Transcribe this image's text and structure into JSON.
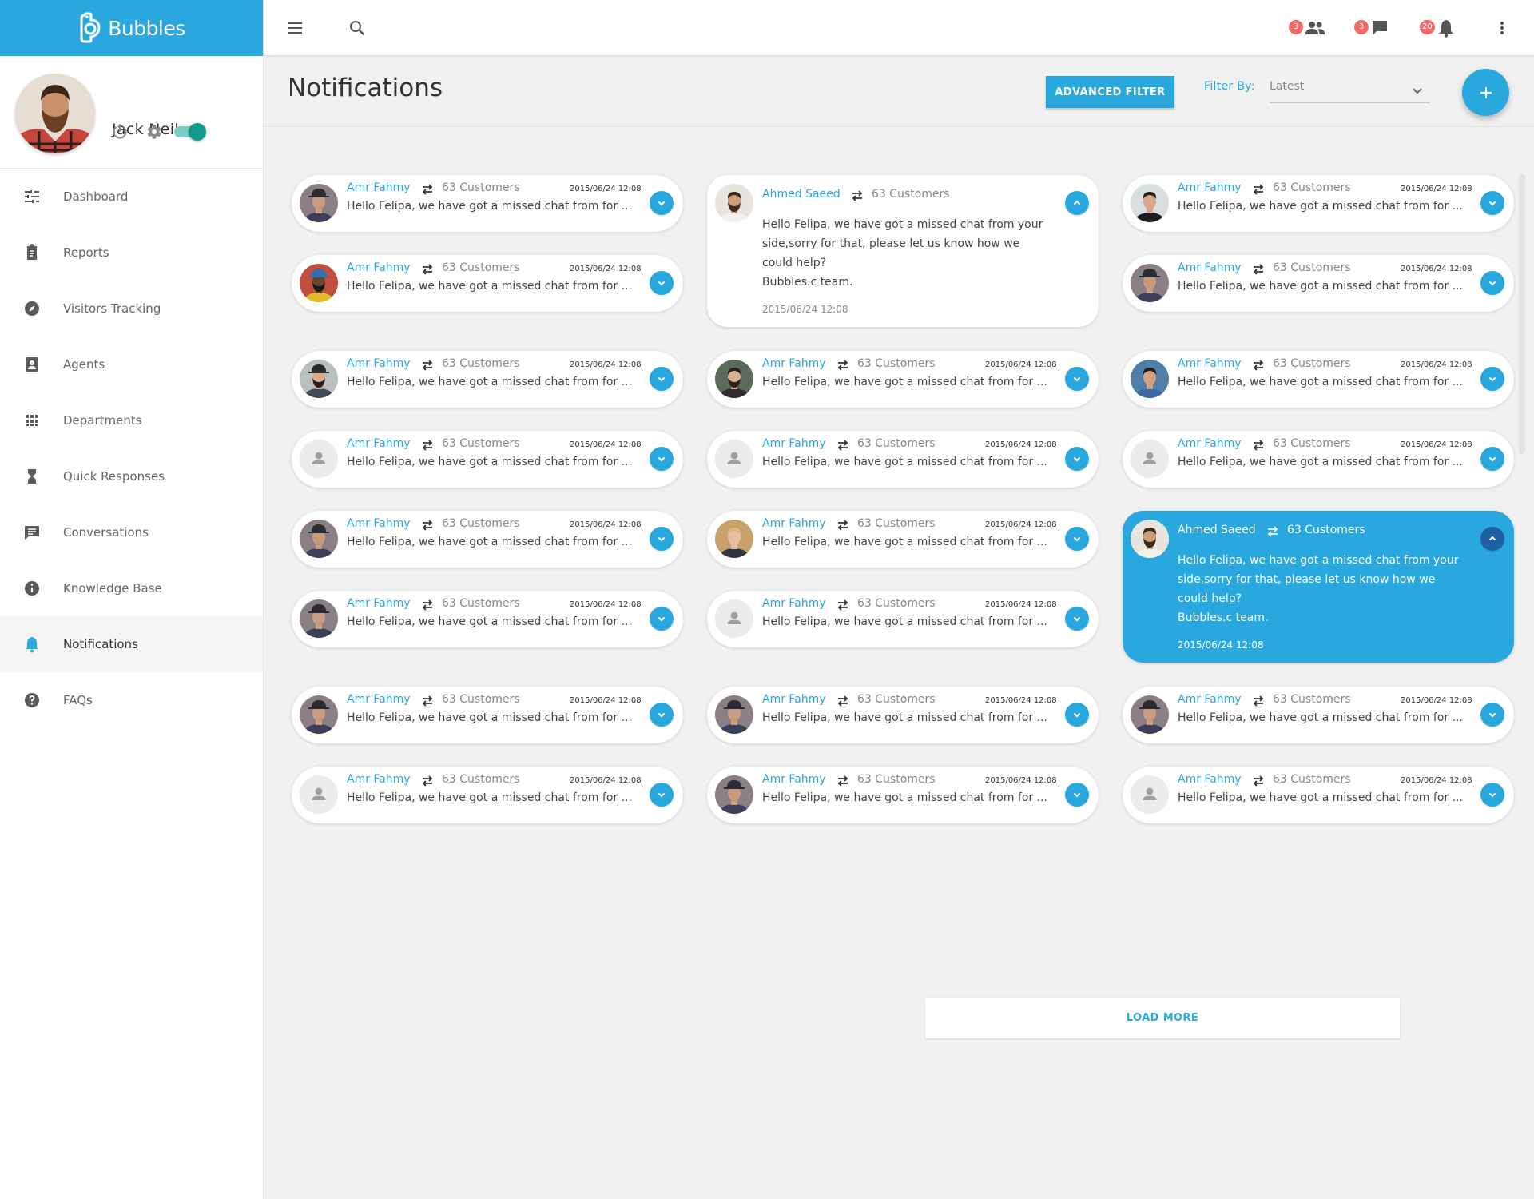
{
  "brand": {
    "name": "Bubbles"
  },
  "user": {
    "name": "Jack Neil"
  },
  "nav": [
    {
      "label": "Dashboard",
      "icon": "tune"
    },
    {
      "label": "Reports",
      "icon": "clipboard"
    },
    {
      "label": "Visitors Tracking",
      "icon": "compass"
    },
    {
      "label": "Agents",
      "icon": "person-box"
    },
    {
      "label": "Departments",
      "icon": "grid"
    },
    {
      "label": "Quick Responses",
      "icon": "hourglass"
    },
    {
      "label": "Conversations",
      "icon": "chat"
    },
    {
      "label": "Knowledge Base",
      "icon": "info"
    },
    {
      "label": "Notifications",
      "icon": "bell",
      "active": true
    },
    {
      "label": "FAQs",
      "icon": "help"
    }
  ],
  "topbar": {
    "badges": {
      "people": "3",
      "chat": "3",
      "notifications": "20"
    }
  },
  "header": {
    "title": "Notifications",
    "advanced_filter": "ADVANCED FILTER",
    "filter_label": "Filter By:",
    "filter_value": "Latest"
  },
  "load_more": "LOAD MORE",
  "colors": {
    "accent": "#29a8e0",
    "dark_accent": "#1d5fa3",
    "toggle": "#0e9a8a",
    "badge": "#f26a6a"
  },
  "cards": [
    {
      "col": 0,
      "row": 0,
      "avatar": "a1",
      "name": "Amr Fahmy",
      "customers": "63 Customers",
      "date": "2015/06/24 12:08",
      "message": "Hello Felipa, we have got a missed chat from for ..."
    },
    {
      "col": 0,
      "row": 1,
      "avatar": "a2",
      "name": "Amr Fahmy",
      "customers": "63 Customers",
      "date": "2015/06/24 12:08",
      "message": "Hello Felipa, we have got a missed chat from for ..."
    },
    {
      "col": 0,
      "row": 2,
      "avatar": "a3",
      "name": "Amr Fahmy",
      "customers": "63 Customers",
      "date": "2015/06/24 12:08",
      "message": "Hello Felipa, we have got a missed chat from for ..."
    },
    {
      "col": 0,
      "row": 3,
      "avatar": "placeholder",
      "name": "Amr Fahmy",
      "customers": "63 Customers",
      "date": "2015/06/24 12:08",
      "message": "Hello Felipa, we have got a missed chat from for ..."
    },
    {
      "col": 0,
      "row": 4,
      "avatar": "a1",
      "name": "Amr Fahmy",
      "customers": "63 Customers",
      "date": "2015/06/24 12:08",
      "message": "Hello Felipa, we have got a missed chat from for ..."
    },
    {
      "col": 0,
      "row": 5,
      "avatar": "a1",
      "name": "Amr Fahmy",
      "customers": "63 Customers",
      "date": "2015/06/24 12:08",
      "message": "Hello Felipa, we have got a missed chat from for ..."
    },
    {
      "col": 0,
      "row": 6,
      "avatar": "a1",
      "name": "Amr Fahmy",
      "customers": "63 Customers",
      "date": "2015/06/24 12:08",
      "message": "Hello Felipa, we have got a missed chat from for ..."
    },
    {
      "col": 0,
      "row": 7,
      "avatar": "placeholder",
      "name": "Amr Fahmy",
      "customers": "63 Customers",
      "date": "2015/06/24 12:08",
      "message": "Hello Felipa, we have got a missed chat from for ..."
    },
    {
      "col": 1,
      "row": 0,
      "avatar": "a4",
      "name": "Ahmed Saeed",
      "customers": "63 Customers",
      "date": "2015/06/24 12:08",
      "open": true,
      "message": "Hello Felipa, we have got a missed chat from your side,sorry for that, please let us know how we could help?",
      "signature": "Bubbles.c team."
    },
    {
      "col": 1,
      "row": 2,
      "avatar": "a5",
      "name": "Amr Fahmy",
      "customers": "63 Customers",
      "date": "2015/06/24 12:08",
      "message": "Hello Felipa, we have got a missed chat from for ..."
    },
    {
      "col": 1,
      "row": 3,
      "avatar": "placeholder",
      "name": "Amr Fahmy",
      "customers": "63 Customers",
      "date": "2015/06/24 12:08",
      "message": "Hello Felipa, we have got a missed chat from for ..."
    },
    {
      "col": 1,
      "row": 4,
      "avatar": "a6",
      "name": "Amr Fahmy",
      "customers": "63 Customers",
      "date": "2015/06/24 12:08",
      "message": "Hello Felipa, we have got a missed chat from for ..."
    },
    {
      "col": 1,
      "row": 5,
      "avatar": "placeholder",
      "name": "Amr Fahmy",
      "customers": "63 Customers",
      "date": "2015/06/24 12:08",
      "message": "Hello Felipa, we have got a missed chat from for ..."
    },
    {
      "col": 1,
      "row": 6,
      "avatar": "a1",
      "name": "Amr Fahmy",
      "customers": "63 Customers",
      "date": "2015/06/24 12:08",
      "message": "Hello Felipa, we have got a missed chat from for ..."
    },
    {
      "col": 1,
      "row": 7,
      "avatar": "a1",
      "name": "Amr Fahmy",
      "customers": "63 Customers",
      "date": "2015/06/24 12:08",
      "message": "Hello Felipa, we have got a missed chat from for ..."
    },
    {
      "col": 2,
      "row": 0,
      "avatar": "a7",
      "name": "Amr Fahmy",
      "customers": "63 Customers",
      "date": "2015/06/24 12:08",
      "message": "Hello Felipa, we have got a missed chat from for ..."
    },
    {
      "col": 2,
      "row": 1,
      "avatar": "a1",
      "name": "Amr Fahmy",
      "customers": "63 Customers",
      "date": "2015/06/24 12:08",
      "message": "Hello Felipa, we have got a missed chat from for ..."
    },
    {
      "col": 2,
      "row": 2,
      "avatar": "a8",
      "name": "Amr Fahmy",
      "customers": "63 Customers",
      "date": "2015/06/24 12:08",
      "message": "Hello Felipa, we have got a missed chat from for ..."
    },
    {
      "col": 2,
      "row": 3,
      "avatar": "placeholder",
      "name": "Amr Fahmy",
      "customers": "63 Customers",
      "date": "2015/06/24 12:08",
      "message": "Hello Felipa, we have got a missed chat from for ..."
    },
    {
      "col": 2,
      "row": 4,
      "avatar": "a4",
      "name": "Ahmed Saeed",
      "customers": "63 Customers",
      "date": "2015/06/24 12:08",
      "open": true,
      "highlight": true,
      "message": "Hello Felipa, we have got a missed chat from your side,sorry for that, please let us know how we could help?",
      "signature": "Bubbles.c team."
    },
    {
      "col": 2,
      "row": 6,
      "avatar": "a1",
      "name": "Amr Fahmy",
      "customers": "63 Customers",
      "date": "2015/06/24 12:08",
      "message": "Hello Felipa, we have got a missed chat from for ..."
    },
    {
      "col": 2,
      "row": 7,
      "avatar": "placeholder",
      "name": "Amr Fahmy",
      "customers": "63 Customers",
      "date": "2015/06/24 12:08",
      "message": "Hello Felipa, we have got a missed chat from for ..."
    }
  ]
}
